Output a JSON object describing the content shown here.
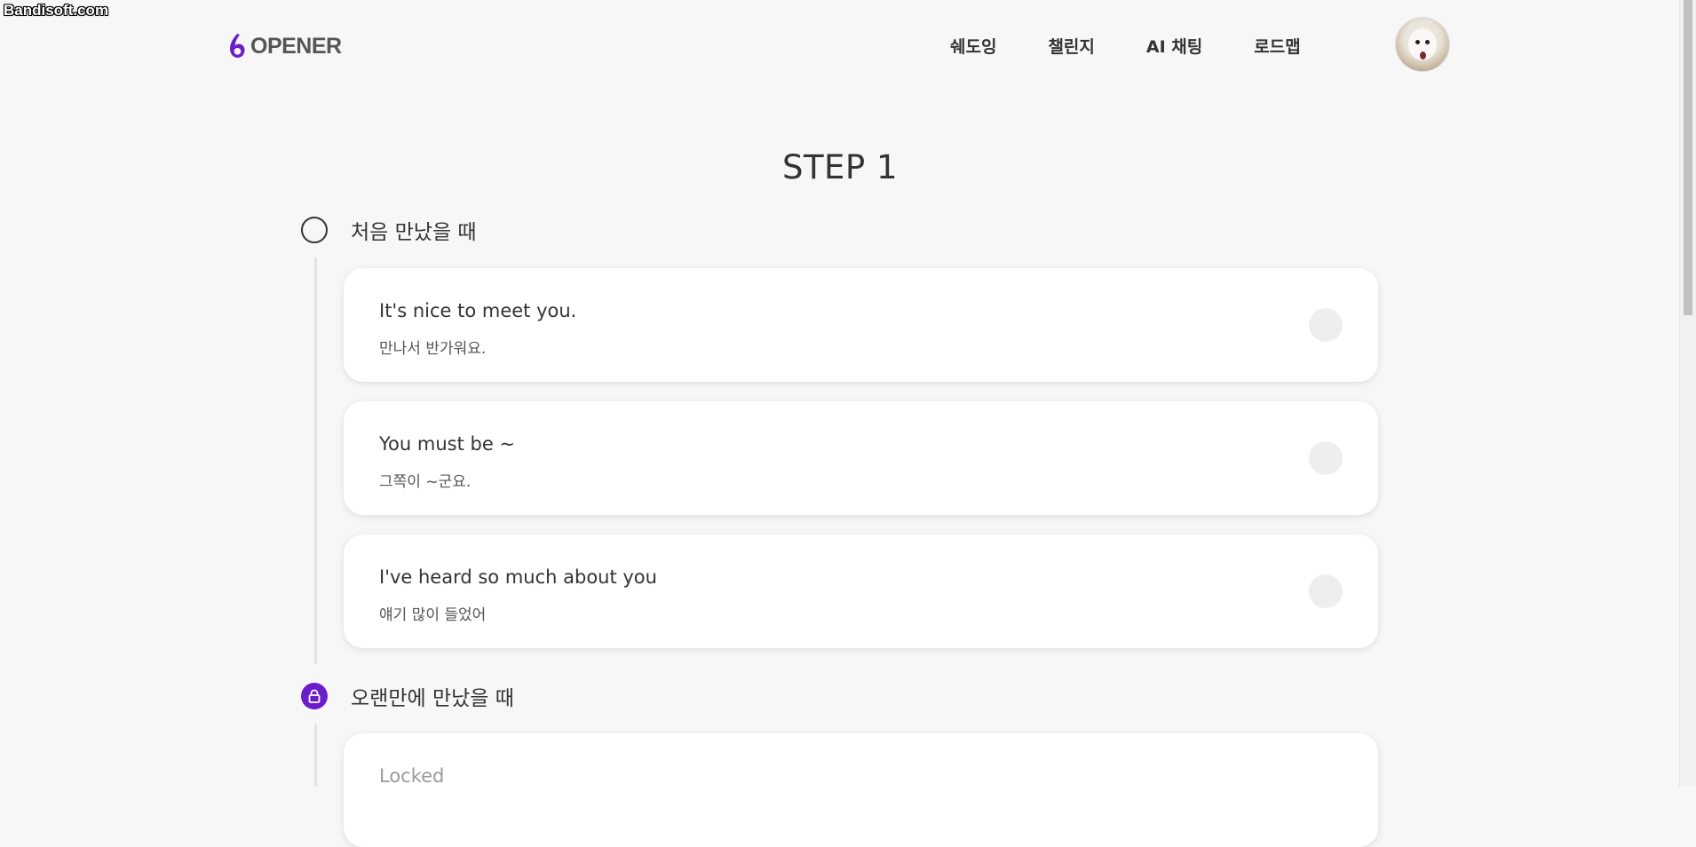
{
  "watermark": "Bandisoft.com",
  "header": {
    "logo_text": "OPENER",
    "nav": [
      "쉐도잉",
      "챌린지",
      "AI 채팅",
      "로드맵"
    ]
  },
  "main": {
    "step_title": "STEP 1",
    "sections": [
      {
        "title": "처음 만났을 때",
        "locked": false,
        "cards": [
          {
            "en": "It's nice to meet you.",
            "ko": "만나서 반가워요."
          },
          {
            "en": "You must be ~",
            "ko": "그쪽이 ~군요."
          },
          {
            "en": "I've heard so much about you",
            "ko": "얘기 많이 들었어"
          }
        ]
      },
      {
        "title": "오랜만에 만났을 때",
        "locked": true,
        "locked_label": "Locked"
      }
    ]
  },
  "colors": {
    "accent": "#6a1ec9",
    "background": "#f7f7f7",
    "card": "#ffffff"
  }
}
